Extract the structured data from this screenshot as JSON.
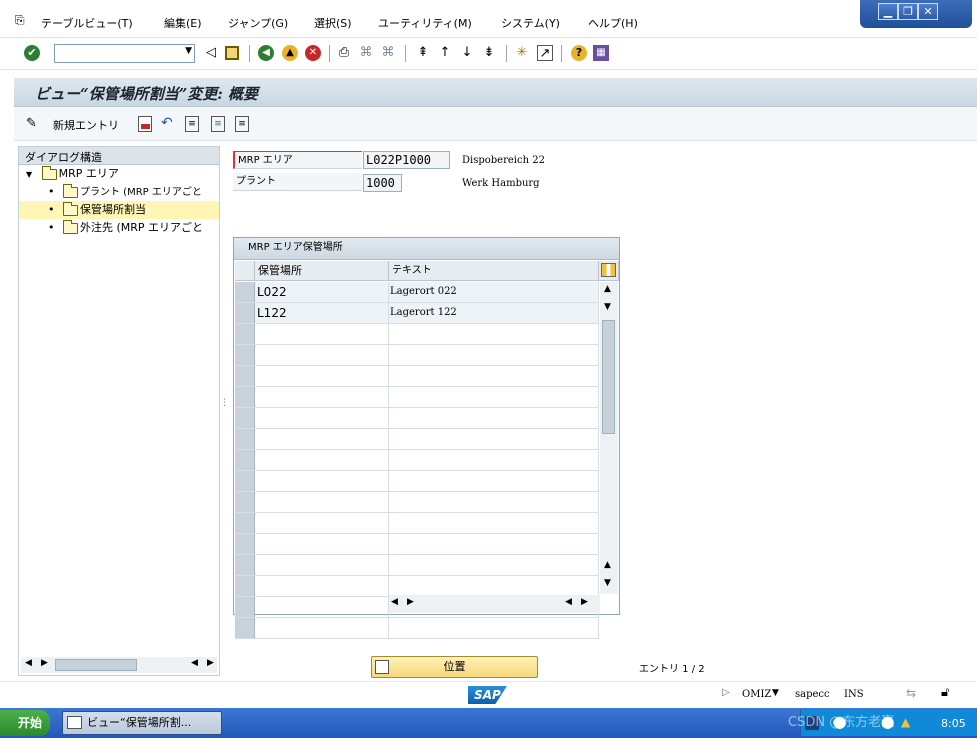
{
  "menu": {
    "items": [
      "テーブルビュー(T)",
      "編集(E)",
      "ジャンプ(G)",
      "選択(S)",
      "ユーティリティ(M)",
      "システム(Y)",
      "ヘルプ(H)"
    ]
  },
  "window_controls": {
    "minimize": "▁",
    "restore": "❐",
    "close": "✕"
  },
  "toolbar": {
    "command_value": ""
  },
  "title": "ビュー“保管場所割当”変更: 概要",
  "app_toolbar": {
    "new_entries_label": "新規エントリ"
  },
  "dialog": {
    "header": "ダイアログ構造",
    "tree": [
      {
        "label": "MRP エリア",
        "level": 0,
        "expanded": true,
        "selected": false
      },
      {
        "label": "プラント (MRP エリアごと",
        "level": 1,
        "selected": false
      },
      {
        "label": "保管場所割当",
        "level": 1,
        "selected": true
      },
      {
        "label": "外注先 (MRP エリアごと",
        "level": 1,
        "selected": false
      }
    ]
  },
  "fields": {
    "mrp_area": {
      "label": "MRP エリア",
      "value": "L022P1000",
      "description": "Dispobereich 22"
    },
    "plant": {
      "label": "プラント",
      "value": "1000",
      "description": "Werk Hamburg"
    }
  },
  "table": {
    "title": "MRP エリア保管場所",
    "columns": [
      "保管場所",
      "テキスト"
    ],
    "rows": [
      {
        "location": "L022",
        "text": "Lagerort 022"
      },
      {
        "location": "L122",
        "text": "Lagerort 122"
      }
    ],
    "empty_rows": 15
  },
  "position_button": "位置",
  "entry_count": "エントリ 1 / 2",
  "statusbar": {
    "logo": "SAP",
    "system": "OMIZ",
    "server": "sapecc",
    "mode": "INS"
  },
  "taskbar": {
    "start": "开始",
    "task": "ビュー“保管場所割...",
    "watermark": "CSDN @东方老赢",
    "clock": "8:05"
  },
  "colors": {
    "title_bar": "#c9d7e3",
    "selected_tree": "#fff5b5",
    "position_button": "#f5d779",
    "taskbar": "#2457b8"
  }
}
